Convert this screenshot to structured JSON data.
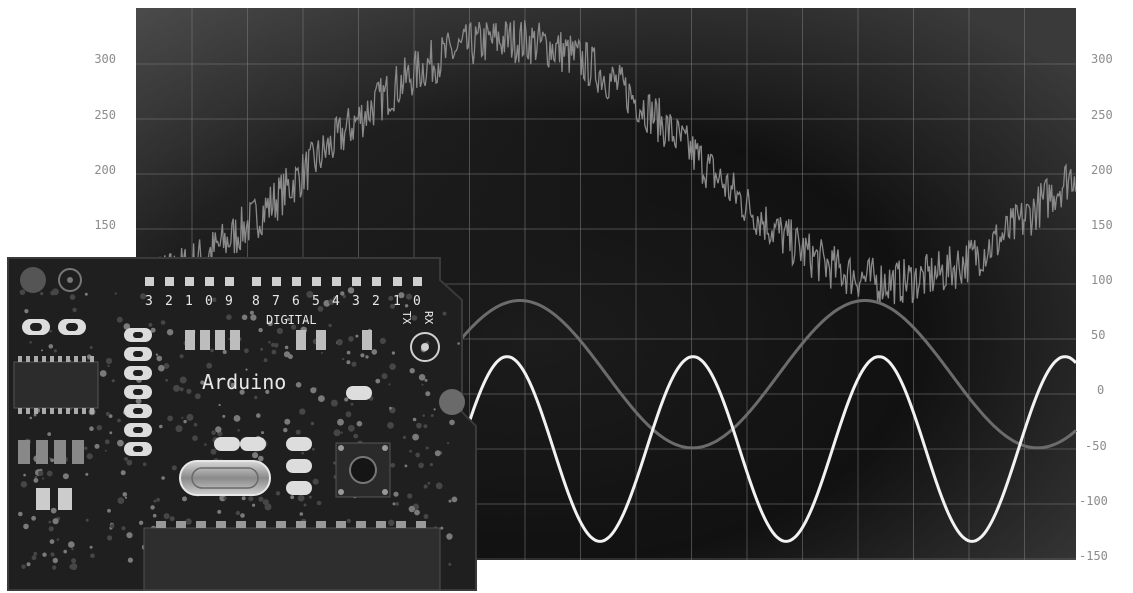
{
  "scope": {
    "y_ticks_left": [
      "300",
      "250",
      "200",
      "150"
    ],
    "y_ticks_right": [
      "300",
      "250",
      "200",
      "150",
      "100",
      "50",
      "0",
      "-50",
      "-100",
      "-150"
    ],
    "grid": true
  },
  "board": {
    "brand": "Arduino",
    "header_label": "DIGITAL",
    "pin_numbers": [
      "3",
      "2",
      "1",
      "0",
      "9",
      "8",
      "7",
      "6",
      "5",
      "4",
      "3",
      "2",
      "1",
      "0"
    ],
    "tx_label": "TX",
    "rx_label": "RX"
  }
}
